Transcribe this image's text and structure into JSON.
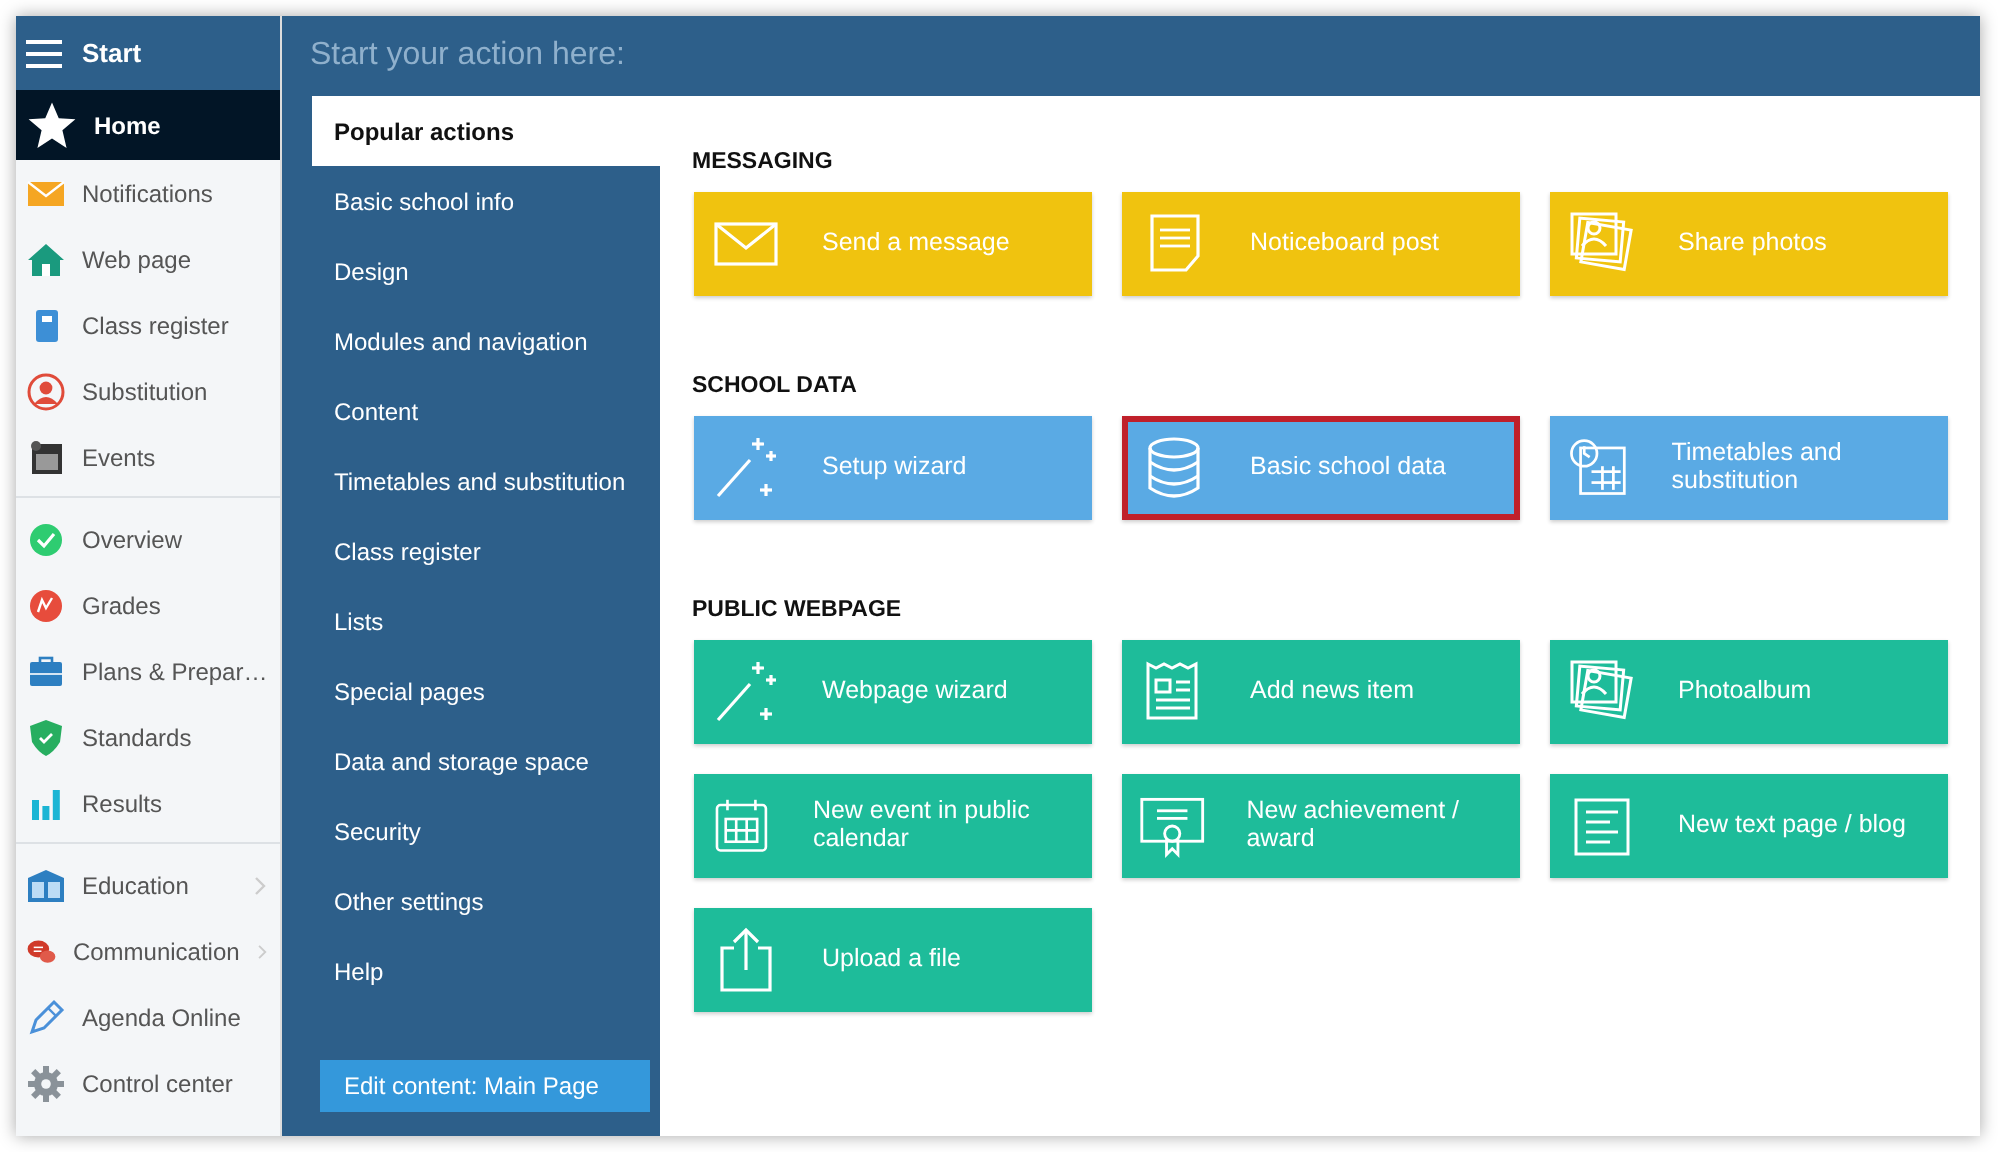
{
  "nav": {
    "title": "Start",
    "groups": [
      {
        "items": [
          {
            "label": "Home",
            "selected": true,
            "submenu": false
          },
          {
            "label": "Notifications",
            "selected": false,
            "submenu": false
          },
          {
            "label": "Web page",
            "selected": false,
            "submenu": false
          },
          {
            "label": "Class register",
            "selected": false,
            "submenu": false
          },
          {
            "label": "Substitution",
            "selected": false,
            "submenu": false
          },
          {
            "label": "Events",
            "selected": false,
            "submenu": false
          }
        ]
      },
      {
        "items": [
          {
            "label": "Overview",
            "selected": false,
            "submenu": false
          },
          {
            "label": "Grades",
            "selected": false,
            "submenu": false
          },
          {
            "label": "Plans & Prepar…",
            "selected": false,
            "submenu": false
          },
          {
            "label": "Standards",
            "selected": false,
            "submenu": false
          },
          {
            "label": "Results",
            "selected": false,
            "submenu": false
          }
        ]
      },
      {
        "items": [
          {
            "label": "Education",
            "selected": false,
            "submenu": true
          },
          {
            "label": "Communication",
            "selected": false,
            "submenu": true
          },
          {
            "label": "Agenda Online",
            "selected": false,
            "submenu": false
          },
          {
            "label": "Control center",
            "selected": false,
            "submenu": false
          }
        ]
      }
    ]
  },
  "search": {
    "placeholder": "Start your action here:"
  },
  "categories": {
    "items": [
      {
        "label": "Popular actions",
        "selected": true
      },
      {
        "label": "Basic school info",
        "selected": false
      },
      {
        "label": "Design",
        "selected": false
      },
      {
        "label": "Modules and navigation",
        "selected": false
      },
      {
        "label": "Content",
        "selected": false
      },
      {
        "label": "Timetables and substitution",
        "selected": false
      },
      {
        "label": "Class register",
        "selected": false
      },
      {
        "label": "Lists",
        "selected": false
      },
      {
        "label": "Special pages",
        "selected": false
      },
      {
        "label": "Data and storage space",
        "selected": false
      },
      {
        "label": "Security",
        "selected": false
      },
      {
        "label": "Other settings",
        "selected": false
      },
      {
        "label": "Help",
        "selected": false
      }
    ],
    "edit_button": "Edit content: Main Page"
  },
  "sections": [
    {
      "title": "MESSAGING",
      "color": "#f0c30f",
      "tiles": [
        {
          "label": "Send a message",
          "selected": false
        },
        {
          "label": "Noticeboard post",
          "selected": false
        },
        {
          "label": "Share photos",
          "selected": false
        }
      ]
    },
    {
      "title": "SCHOOL DATA",
      "color": "#5aaae4",
      "tiles": [
        {
          "label": "Setup wizard",
          "selected": false
        },
        {
          "label": "Basic school data",
          "selected": true
        },
        {
          "label": "Timetables and substitution",
          "selected": false
        }
      ]
    },
    {
      "title": "PUBLIC WEBPAGE",
      "color": "#1ebc9a",
      "tiles": [
        {
          "label": "Webpage wizard",
          "selected": false
        },
        {
          "label": "Add news item",
          "selected": false
        },
        {
          "label": "Photoalbum",
          "selected": false
        },
        {
          "label": "New event in public calendar",
          "selected": false
        },
        {
          "label": "New achievement / award",
          "selected": false
        },
        {
          "label": "New text page / blog",
          "selected": false
        },
        {
          "label": "Upload a file",
          "selected": false
        }
      ]
    }
  ]
}
